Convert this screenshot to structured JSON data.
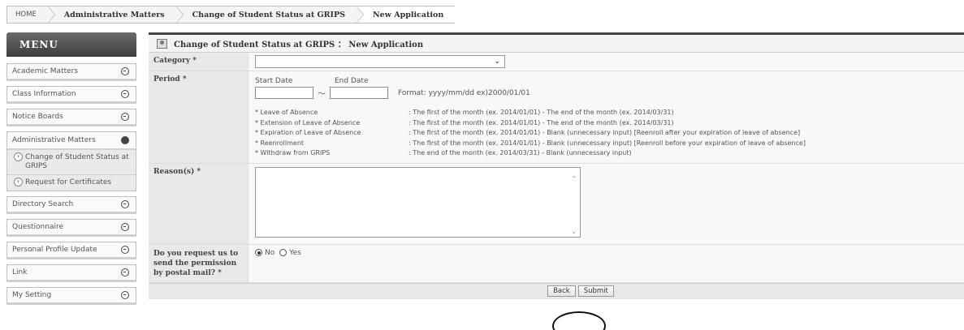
{
  "breadcrumb": [
    "HOME",
    "Administrative Matters",
    "Change of Student Status at GRIPS",
    "New Application"
  ],
  "menu": {
    "title": "MENU",
    "items": [
      {
        "label": "Academic Matters"
      },
      {
        "label": "Class Information"
      },
      {
        "label": "Notice Boards"
      },
      {
        "label": "Administrative Matters",
        "expanded": true,
        "sub": [
          "Change of Student Status at GRIPS",
          "Request for Certificates"
        ]
      },
      {
        "label": "Directory Search"
      },
      {
        "label": "Questionnaire"
      },
      {
        "label": "Personal Profile Update"
      },
      {
        "label": "Link"
      },
      {
        "label": "My Setting"
      }
    ]
  },
  "panel": {
    "title": "Change of Student Status at GRIPS ： New Application"
  },
  "form": {
    "category_label": "Category *",
    "category_value": "",
    "period_label": "Period *",
    "start_date_label": "Start Date",
    "end_date_label": "End Date",
    "tilde": "～",
    "format_hint": "Format: yyyy/mm/dd  ex)2000/01/01",
    "rules": [
      {
        "k": "* Leave of Absence",
        "v": ": The first of the month (ex. 2014/01/01) - The end of the month (ex. 2014/03/31)"
      },
      {
        "k": "* Extension of Leave of Absence",
        "v": ": The first of the month (ex. 2014/01/01) - The end of the month (ex. 2014/03/31)"
      },
      {
        "k": "* Expiration of Leave of Absence",
        "v": ": The first of the month (ex. 2014/01/01) - Blank (unnecessary input) [Reenroll after your expiration of leave of absence]"
      },
      {
        "k": "* Reenrollment",
        "v": ": The first of the month (ex. 2014/01/01) - Blank (unnecessary input) [Reenroll before your expiration of leave of absence]"
      },
      {
        "k": "* Withdraw from GRIPS",
        "v": ": The end of the month (ex. 2014/03/31) - Blank (unnecessary input)"
      }
    ],
    "reason_label": "Reason(s) *",
    "mail_label": "Do you request us to send the permission by postal mail? *",
    "mail_options": [
      "No",
      "Yes"
    ],
    "mail_selected": "No"
  },
  "buttons": {
    "back": "Back",
    "submit": "Submit"
  },
  "icons": {
    "menu_toggle": "circle-minus-icon",
    "title_icon": "form-user-icon",
    "select_arrow": "chevron-down-icon"
  }
}
